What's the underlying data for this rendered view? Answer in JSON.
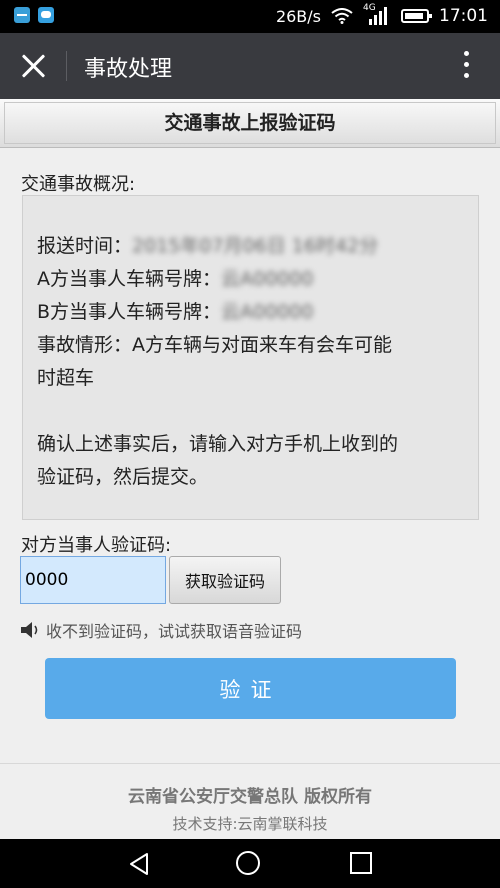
{
  "status_bar": {
    "speed": "26B/s",
    "network": "4G",
    "time": "17:01"
  },
  "top_bar": {
    "title": "事故处理"
  },
  "section": {
    "title": "交通事故上报验证码"
  },
  "overview": {
    "label": "交通事故概况:",
    "report_time_label": "报送时间：",
    "report_time_value": "2015年07月06日 16时42分",
    "party_a_label": "A方当事人车辆号牌：",
    "party_a_value": "云A00000",
    "party_b_label": "B方当事人车辆号牌：",
    "party_b_value": "云A00000",
    "situation_line1": "事故情形：A方车辆与对面来车有会车可能",
    "situation_line2": "时超车",
    "confirm_line1": "确认上述事实后，请输入对方手机上收到的",
    "confirm_line2": "验证码，然后提交。"
  },
  "verify": {
    "label": "对方当事人验证码:",
    "input_value": "0000",
    "get_code_label": "获取验证码",
    "voice_hint": "收不到验证码，试试获取语音验证码",
    "submit_label": "验证"
  },
  "footer": {
    "line1": "云南省公安厅交警总队 版权所有",
    "line2": "技术支持:云南掌联科技"
  },
  "icons": {
    "close": "close-icon",
    "more": "more-vertical-icon",
    "speaker": "speaker-icon",
    "back": "nav-back-icon",
    "home": "nav-home-icon",
    "recent": "nav-recent-icon"
  },
  "colors": {
    "topbar": "#393a3f",
    "verify_button": "#58aaea",
    "input_bg": "#d3e9fd"
  }
}
